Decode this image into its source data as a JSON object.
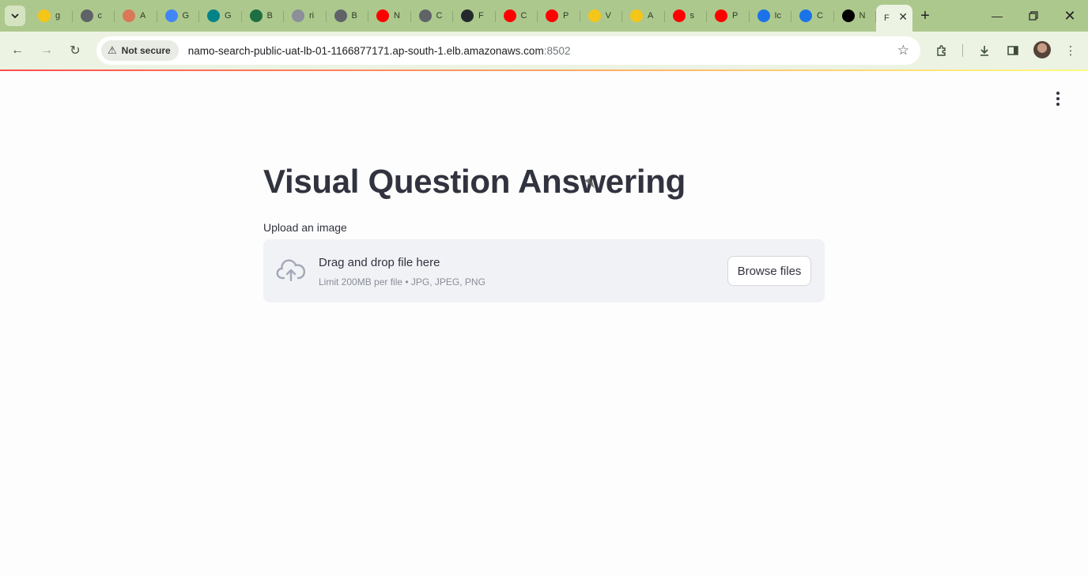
{
  "browser": {
    "tabs": [
      {
        "icon": "hugging-face-icon",
        "title": "g",
        "color": "#f5c518"
      },
      {
        "icon": "openai-icon",
        "title": "c",
        "color": "#5f6368"
      },
      {
        "icon": "anthropic-icon",
        "title": "A",
        "color": "#d97757"
      },
      {
        "icon": "gemini-icon",
        "title": "G",
        "color": "#4285f4"
      },
      {
        "icon": "sharepoint-icon",
        "title": "G",
        "color": "#038387"
      },
      {
        "icon": "excel-icon",
        "title": "B",
        "color": "#1d6f42"
      },
      {
        "icon": "page-icon",
        "title": "ri",
        "color": "#8a8f99"
      },
      {
        "icon": "globe-icon",
        "title": "B",
        "color": "#5f6368"
      },
      {
        "icon": "youtube-icon",
        "title": "N",
        "color": "#ff0000"
      },
      {
        "icon": "globe-icon",
        "title": "C",
        "color": "#5f6368"
      },
      {
        "icon": "github-icon",
        "title": "F",
        "color": "#24292e"
      },
      {
        "icon": "youtube-icon",
        "title": "C",
        "color": "#ff0000"
      },
      {
        "icon": "youtube-icon",
        "title": "P",
        "color": "#ff0000"
      },
      {
        "icon": "hugging-face-icon",
        "title": "V",
        "color": "#f5c518"
      },
      {
        "icon": "hugging-face-icon",
        "title": "A",
        "color": "#f5c518"
      },
      {
        "icon": "youtube-icon",
        "title": "s",
        "color": "#ff0000"
      },
      {
        "icon": "youtube-icon",
        "title": "P",
        "color": "#ff0000"
      },
      {
        "icon": "bracket-icon",
        "title": "Ic",
        "color": "#1a73e8"
      },
      {
        "icon": "bracket-icon",
        "title": "C",
        "color": "#1a73e8"
      },
      {
        "icon": "notion-icon",
        "title": "N",
        "color": "#000000"
      }
    ],
    "active_tab": {
      "title": "F"
    },
    "security_label": "Not secure",
    "url_host": "namo-search-public-uat-lb-01-1166877171.ap-south-1.elb.amazonaws.com",
    "url_port": ":8502"
  },
  "page": {
    "title": "Visual Question Answering",
    "upload_label": "Upload an image",
    "dropzone_main": "Drag and drop file here",
    "dropzone_sub": "Limit 200MB per file • JPG, JPEG, PNG",
    "browse_button": "Browse files",
    "accent_color": "#ff4b4b"
  }
}
